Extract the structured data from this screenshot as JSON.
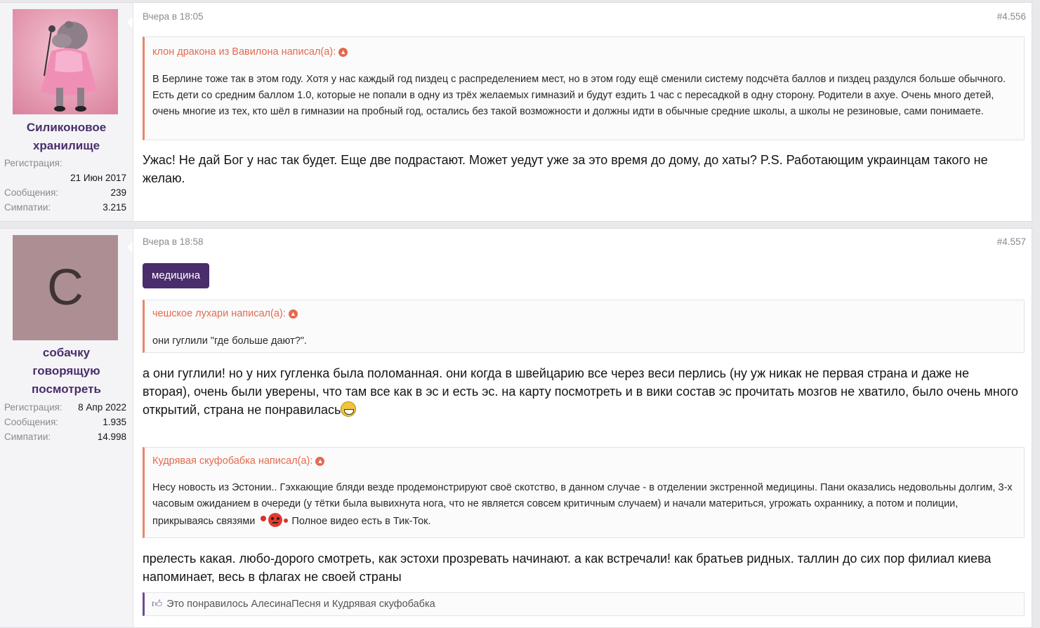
{
  "posts": [
    {
      "user": {
        "name_line1": "Силиконовое",
        "name_line2": "хранилище",
        "avatar_desc": "hippo-singer-avatar",
        "reg_label": "Регистрация:",
        "reg_value": "21 Июн 2017",
        "msgs_label": "Сообщения:",
        "msgs_value": "239",
        "likes_label": "Симпатии:",
        "likes_value": "3.215"
      },
      "date": "Вчера в 18:05",
      "number": "#4.556",
      "quote": {
        "author": "клон дракона из Вавилона написал(а):",
        "text": "В Берлине тоже так в этом году. Хотя у нас каждый год пиздец с распределением мест, но в этом году ещё сменили систему подсчёта баллов и пиздец раздулся больше обычного. Есть дети со средним баллом 1.0, которые не попали в одну из трёх желаемых гимназий и будут ездить 1 час с пересадкой в одну сторону. Родители в ахуе. Очень много детей, очень многие из тех, кто шёл в гимназии на пробный год, остались без такой возможности и должны идти в обычные средние школы, а школы не резиновые, сами понимаете."
      },
      "message": "Ужас! Не дай Бог у нас так будет. Еще две подрастают. Может уедут уже за это время до дому, до хаты? P.S. Работающим украинцам такого не желаю."
    },
    {
      "user": {
        "avatar_letter": "С",
        "name_line1": "собачку",
        "name_line2": "говорящую",
        "name_line3": "посмотреть",
        "reg_label": "Регистрация:",
        "reg_value": "8 Апр 2022",
        "msgs_label": "Сообщения:",
        "msgs_value": "1.935",
        "likes_label": "Симпатии:",
        "likes_value": "14.998"
      },
      "date": "Вчера в 18:58",
      "number": "#4.557",
      "tag": "медицина",
      "quote1": {
        "author": "чешское лухари написал(а):",
        "text": "они гуглили \"где больше дают?\"."
      },
      "message1": "а они гуглили! но у них гугленка была поломанная. они когда в швейцарию все через веси перлись (ну уж никак не первая страна и даже не вторая), очень были уверены, что там все как в эс и есть эс. на карту посмотреть и в вики состав эс прочитать мозгов не хватило, было очень много открытий, страна не понравилась",
      "quote2": {
        "author": "Кудрявая скуфобабка написал(а):",
        "text_before": "Несу новость из Эстонии.. Гэхкающие бляди везде продемонстрируют своё скотство, в данном случае - в отделении экстренной медицины. Пани оказались недовольны долгим, 3-х часовым ожиданием в очереди (у тётки была вывихнута нога, что не является совсем критичным случаем) и начали материться, угрожать охраннику, а потом и полиции, прикрываясь связями",
        "text_after": " Полное видео есть в Тик-Ток."
      },
      "message2": "прелесть какая. любо-дорого смотреть, как эстохи прозревать начинают. а как встречали! как братьев ридных. таллин до сих пор филиал киева напоминает, весь в флагах не своей страны",
      "likes_text": "Это понравилось АлесинаПесня и Кудрявая скуфобабка"
    }
  ],
  "colors": {
    "accent": "#4a2d6c",
    "quote_border": "#e8856a",
    "quote_author": "#e46a4c"
  }
}
